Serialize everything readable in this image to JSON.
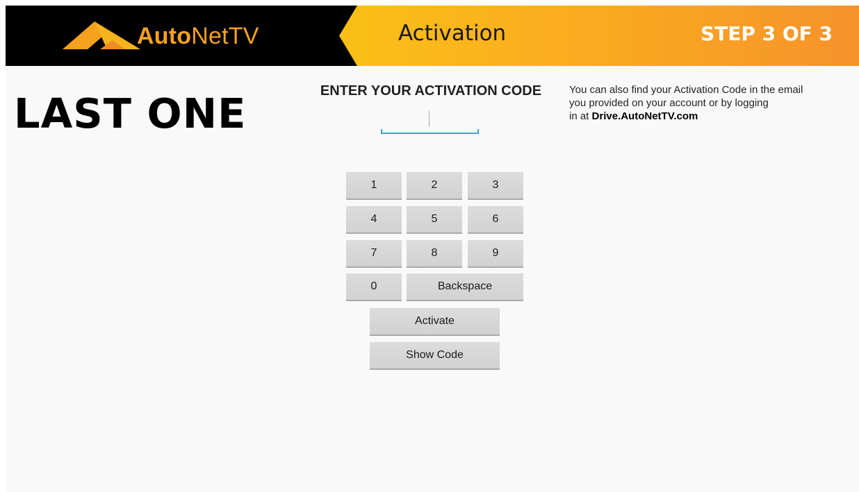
{
  "header": {
    "logo_bold": "Auto",
    "logo_regular": "NetTV",
    "title": "Activation",
    "step": "STEP 3 OF 3",
    "colors": {
      "band": "#000000",
      "orange_start": "#fbbf17",
      "orange_end": "#f6922b",
      "logo": "#f4a11e"
    }
  },
  "main": {
    "hero_text": "LAST ONE",
    "code_heading": "ENTER YOUR ACTIVATION CODE",
    "activation_code": {
      "value": "",
      "placeholder": ""
    },
    "help": {
      "line1": "You can also find your Activation Code in the email",
      "line2": "you provided on your account or by logging",
      "line3_prefix": "in at",
      "link": "Drive.AutoNetTV.com"
    }
  },
  "keypad": {
    "keys": [
      "1",
      "2",
      "3",
      "4",
      "5",
      "6",
      "7",
      "8",
      "9",
      "0"
    ],
    "backspace": "Backspace",
    "activate": "Activate",
    "show_code": "Show Code"
  },
  "icons": {
    "logo": "autonettv-triangle-icon"
  }
}
